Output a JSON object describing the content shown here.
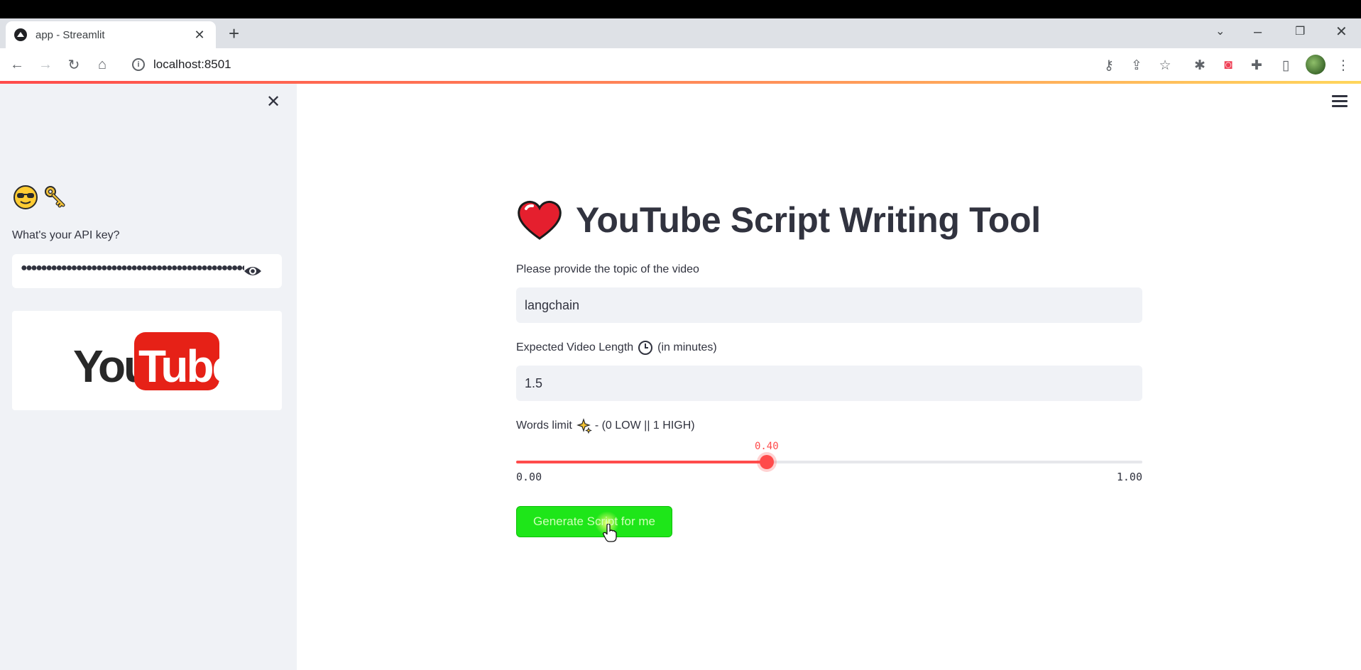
{
  "browser": {
    "tab_title": "app - Streamlit",
    "new_tab_icon": "plus-icon",
    "url": "localhost:8501",
    "window_controls": [
      "chevron-down-icon",
      "minimize-icon",
      "restore-icon",
      "close-icon"
    ],
    "toolbar_icons": [
      "key-icon",
      "share-icon",
      "star-icon",
      "extension-bug-icon",
      "pocket-icon",
      "puzzle-icon",
      "sidepanel-icon",
      "profile-avatar",
      "kebab-menu-icon"
    ]
  },
  "sidebar": {
    "emojis": [
      "😎",
      "🔑"
    ],
    "api_key_label": "What's your API key?",
    "api_key_value": "●●●●●●●●●●●●●●●●●●●●●●●●●●●●●●●●●●●●●●●●●●●●●●●●●●●",
    "logo": {
      "you": "You",
      "tube": "Tube"
    }
  },
  "main": {
    "title": "YouTube Script Writing Tool",
    "topic_label": "Please provide the topic of the video",
    "topic_value": "langchain",
    "length_label_before": "Expected Video Length",
    "length_label_after": "(in minutes)",
    "length_value": "1.5",
    "words_label_before": "Words limit",
    "words_label_after": "- (0 LOW || 1 HIGH)",
    "slider": {
      "min": 0.0,
      "max": 1.0,
      "value": 0.4,
      "min_label": "0.00",
      "max_label": "1.00",
      "value_label": "0.40"
    },
    "button_label": "Generate Script for me"
  },
  "colors": {
    "accent": "#ff4b4b",
    "button": "#1ee619",
    "sidebar_bg": "#f0f2f6",
    "youtube_red": "#e62117"
  }
}
